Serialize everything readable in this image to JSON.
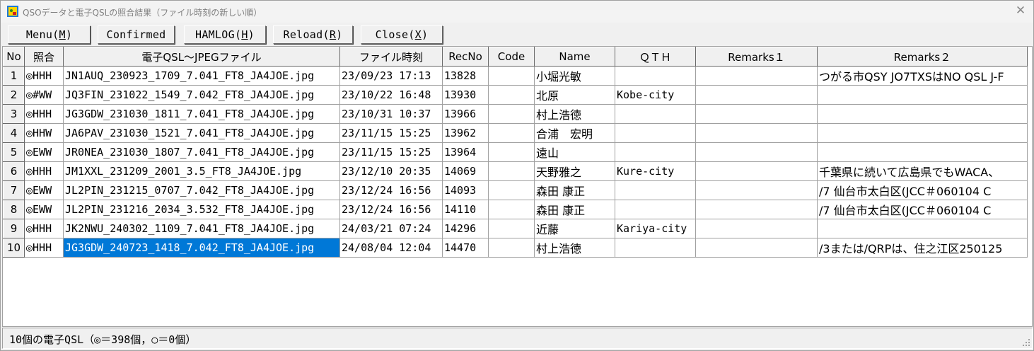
{
  "window": {
    "title": "QSOデータと電子QSLの照合結果（ファイル時刻の新しい順）"
  },
  "toolbar": {
    "menu": {
      "label": "Menu(",
      "hotkey": "M",
      "suffix": ")"
    },
    "confirmed": {
      "label": "Confirmed"
    },
    "hamlog": {
      "label": "HAMLOG(",
      "hotkey": "H",
      "suffix": ")"
    },
    "reload": {
      "label": "Reload(",
      "hotkey": "R",
      "suffix": ")"
    },
    "close": {
      "label": "Close(",
      "hotkey": "X",
      "suffix": ")"
    }
  },
  "grid": {
    "headers": [
      "No",
      "照合",
      "電子QSL～JPEGファイル",
      "ファイル時刻",
      "RecNo",
      "Code",
      "Name",
      "ＱＴＨ",
      "Remarks１",
      "Remarks２"
    ],
    "selected_row": 10,
    "rows": [
      {
        "no": "1",
        "match": "◎HHH",
        "file": "JN1AUQ_230923_1709_7.041_FT8_JA4JOE.jpg",
        "time": "23/09/23 17:13",
        "recno": "13828",
        "code": "",
        "name": "小堀光敏",
        "qth": "",
        "rem1": "",
        "rem2": "つがる市QSY JO7TXSはNO QSL J-F"
      },
      {
        "no": "2",
        "match": "◎#WW",
        "file": "JQ3FIN_231022_1549_7.042_FT8_JA4JOE.jpg",
        "time": "23/10/22 16:48",
        "recno": "13930",
        "code": "",
        "name": "北原",
        "qth": "Kobe-city",
        "rem1": "",
        "rem2": ""
      },
      {
        "no": "3",
        "match": "◎HHH",
        "file": "JG3GDW_231030_1811_7.041_FT8_JA4JOE.jpg",
        "time": "23/10/31 10:37",
        "recno": "13966",
        "code": "",
        "name": "村上浩徳",
        "qth": "",
        "rem1": "",
        "rem2": ""
      },
      {
        "no": "4",
        "match": "◎HHW",
        "file": "JA6PAV_231030_1521_7.041_FT8_JA4JOE.jpg",
        "time": "23/11/15 15:25",
        "recno": "13962",
        "code": "",
        "name": "合浦　宏明",
        "qth": "",
        "rem1": "",
        "rem2": ""
      },
      {
        "no": "5",
        "match": "◎EWW",
        "file": "JR0NEA_231030_1807_7.041_FT8_JA4JOE.jpg",
        "time": "23/11/15 15:25",
        "recno": "13964",
        "code": "",
        "name": "遠山",
        "qth": "",
        "rem1": "",
        "rem2": ""
      },
      {
        "no": "6",
        "match": "◎HHH",
        "file": "JM1XXL_231209_2001_3.5_FT8_JA4JOE.jpg",
        "time": "23/12/10 20:35",
        "recno": "14069",
        "code": "",
        "name": "天野雅之",
        "qth": "Kure-city",
        "rem1": "",
        "rem2": "千葉県に続いて広島県でもWACA、"
      },
      {
        "no": "7",
        "match": "◎EWW",
        "file": "JL2PIN_231215_0707_7.042_FT8_JA4JOE.jpg",
        "time": "23/12/24 16:56",
        "recno": "14093",
        "code": "",
        "name": "森田 康正",
        "qth": "",
        "rem1": "",
        "rem2": "/7 仙台市太白区(JCC＃060104  C"
      },
      {
        "no": "8",
        "match": "◎EWW",
        "file": "JL2PIN_231216_2034_3.532_FT8_JA4JOE.jpg",
        "time": "23/12/24 16:56",
        "recno": "14110",
        "code": "",
        "name": "森田 康正",
        "qth": "",
        "rem1": "",
        "rem2": "/7 仙台市太白区(JCC＃060104  C"
      },
      {
        "no": "9",
        "match": "◎HHH",
        "file": "JK2NWU_240302_1109_7.041_FT8_JA4JOE.jpg",
        "time": "24/03/21 07:24",
        "recno": "14296",
        "code": "",
        "name": "近藤",
        "qth": "Kariya-city",
        "rem1": "",
        "rem2": ""
      },
      {
        "no": "10",
        "match": "◎HHH",
        "file": "JG3GDW_240723_1418_7.042_FT8_JA4JOE.jpg",
        "time": "24/08/04 12:04",
        "recno": "14470",
        "code": "",
        "name": "村上浩徳",
        "qth": "",
        "rem1": "",
        "rem2": "/3または/QRPは、住之江区250125"
      }
    ]
  },
  "status": {
    "text": "10個の電子QSL（◎＝398個，○＝0個）"
  },
  "colors": {
    "selection": "#0078d7",
    "face": "#f0f0f0"
  },
  "icons": {
    "app": "app-icon",
    "close": "close-icon",
    "grip": "size-grip-icon"
  }
}
